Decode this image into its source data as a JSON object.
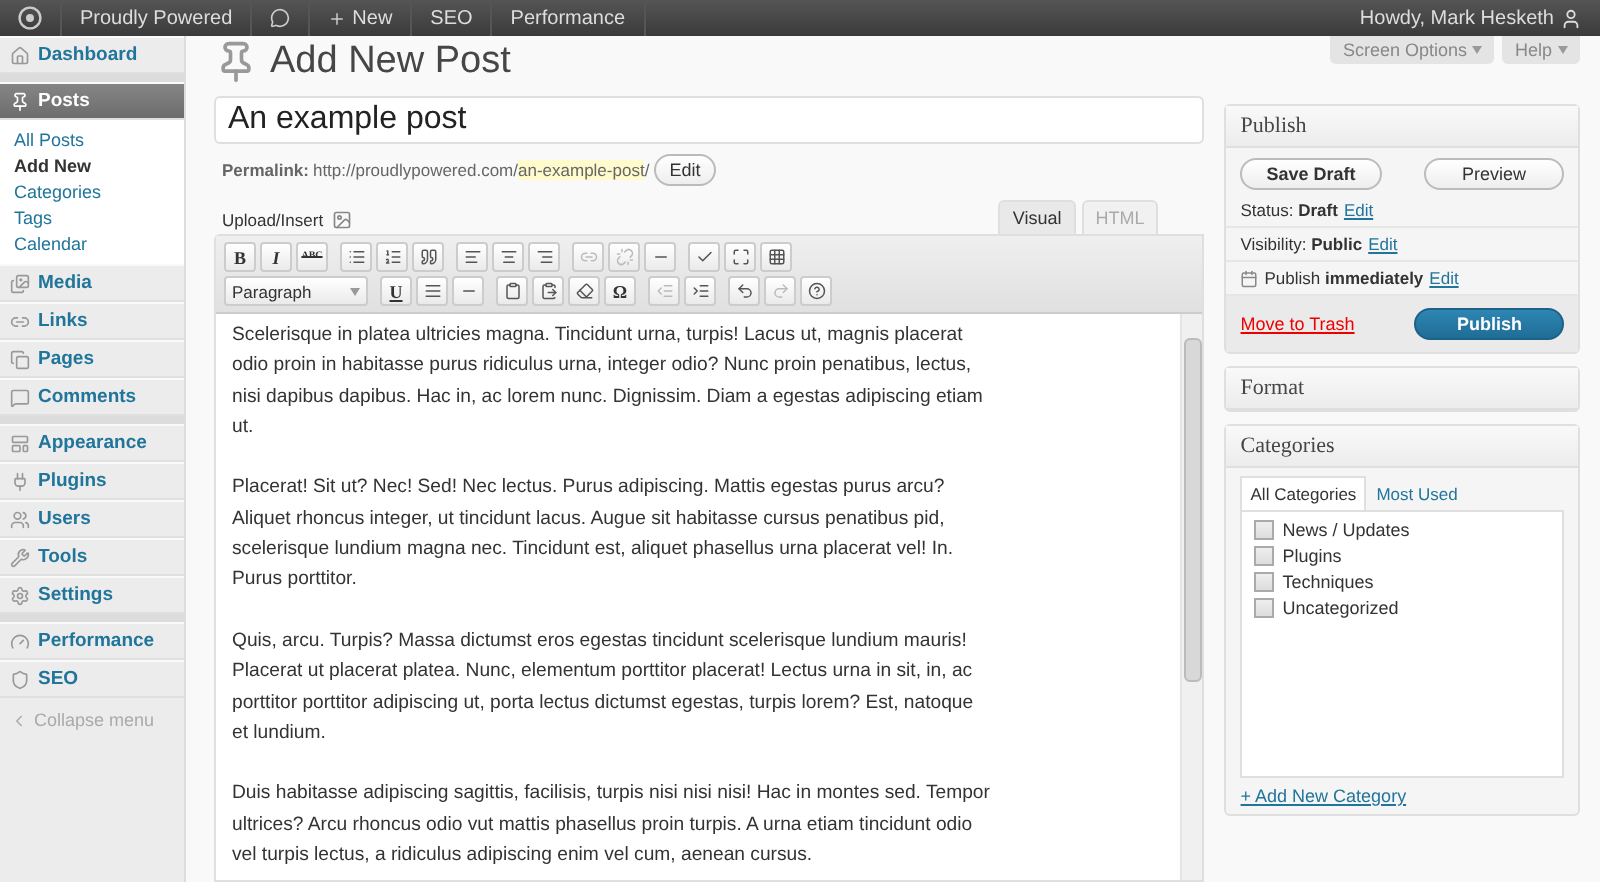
{
  "admin_bar": {
    "site": "Proudly Powered",
    "new_label": "New",
    "links": [
      "SEO",
      "Performance"
    ],
    "greeting": "Howdy, Mark Hesketh"
  },
  "screen_meta": [
    "Screen Options",
    "Help"
  ],
  "sidebar": {
    "groups": [
      [
        {
          "label": "Dashboard",
          "selected": false
        }
      ],
      [
        {
          "label": "Posts",
          "selected": true,
          "children": [
            {
              "label": "All Posts",
              "selected": false
            },
            {
              "label": "Add New",
              "selected": true
            },
            {
              "label": "Categories",
              "selected": false
            },
            {
              "label": "Tags",
              "selected": false
            },
            {
              "label": "Calendar",
              "selected": false
            }
          ]
        },
        {
          "label": "Media",
          "selected": false
        },
        {
          "label": "Links",
          "selected": false
        },
        {
          "label": "Pages",
          "selected": false
        },
        {
          "label": "Comments",
          "selected": false
        }
      ],
      [
        {
          "label": "Appearance",
          "selected": false
        },
        {
          "label": "Plugins",
          "selected": false
        },
        {
          "label": "Users",
          "selected": false
        },
        {
          "label": "Tools",
          "selected": false
        },
        {
          "label": "Settings",
          "selected": false
        }
      ],
      [
        {
          "label": "Performance",
          "selected": false
        },
        {
          "label": "SEO",
          "selected": false
        }
      ]
    ],
    "collapse": "Collapse menu"
  },
  "page_title": "Add New Post",
  "post_title": "An example post",
  "permalink": {
    "label": "Permalink:",
    "base": "http://proudlypowered.com/",
    "slug": "an-example-post",
    "tail": "/",
    "edit": "Edit"
  },
  "upload_label": "Upload/Insert",
  "editor_tabs": [
    {
      "label": "Visual",
      "selected": true
    },
    {
      "label": "HTML",
      "selected": false
    }
  ],
  "toolbar": {
    "bold": "B",
    "italic": "I",
    "strike": "ABC",
    "format": "Paragraph",
    "underline": "U",
    "special_char": "Ω"
  },
  "content": [
    "Scelerisque in platea ultricies magna. Tincidunt urna, turpis! Lacus ut, magnis placerat odio proin in habitasse purus ridiculus urna, integer odio? Nunc proin penatibus, lectus, nisi dapibus dapibus. Hac in, ac lorem nunc. Dignissim. Diam a egestas adipiscing etiam ut.",
    "Placerat! Sit ut? Nec! Sed! Nec lectus. Purus adipiscing. Mattis egestas purus arcu? Aliquet rhoncus integer, ut tincidunt lacus. Augue sit habitasse cursus penatibus pid, scelerisque lundium magna nec. Tincidunt est, aliquet phasellus urna placerat vel! In. Purus porttitor.",
    "Quis, arcu. Turpis? Massa dictumst eros egestas tincidunt scelerisque lundium mauris! Placerat ut placerat platea. Nunc, elementum porttitor placerat! Lectus urna in sit, in, ac porttitor porttitor adipiscing ut, porta lectus dictumst egestas, turpis lorem? Est, natoque et lundium.",
    "Duis habitasse adipiscing sagittis, facilisis, turpis nisi nisi nisi! Hac in montes sed. Tempor ultrices? Arcu rhoncus odio vut mattis phasellus proin turpis. A urna etiam tincidunt odio vel turpis lectus, a ridiculus adipiscing enim vel cum, aenean cursus."
  ],
  "publish": {
    "title": "Publish",
    "save_draft": "Save Draft",
    "preview": "Preview",
    "rows": [
      {
        "label": "Status:",
        "value": "Draft",
        "link": "Edit"
      },
      {
        "label": "Visibility:",
        "value": "Public",
        "link": "Edit"
      },
      {
        "label": "Publish",
        "value": "immediately",
        "link": "Edit"
      }
    ],
    "trash": "Move to Trash",
    "publish": "Publish"
  },
  "format": {
    "title": "Format"
  },
  "categories": {
    "title": "Categories",
    "tabs": [
      {
        "label": "All Categories",
        "selected": true
      },
      {
        "label": "Most Used",
        "selected": false
      }
    ],
    "items": [
      {
        "label": "News / Updates",
        "checked": false
      },
      {
        "label": "Plugins",
        "checked": false
      },
      {
        "label": "Techniques",
        "checked": false
      },
      {
        "label": "Uncategorized",
        "checked": false
      }
    ],
    "add": "+ Add New Category"
  }
}
